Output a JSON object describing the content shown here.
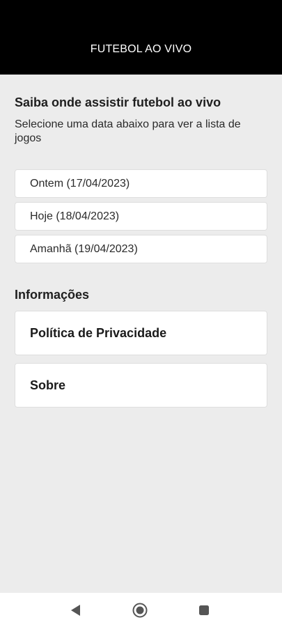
{
  "app_bar": {
    "title": "FUTEBOL AO VIVO"
  },
  "intro": {
    "heading": "Saiba onde assistir futebol ao vivo",
    "subheading": "Selecione uma data abaixo para ver a lista de jogos"
  },
  "dates": [
    {
      "label": "Ontem (17/04/2023)"
    },
    {
      "label": "Hoje (18/04/2023)"
    },
    {
      "label": "Amanhã (19/04/2023)"
    }
  ],
  "info": {
    "title": "Informações",
    "items": [
      {
        "label": "Política de Privacidade"
      },
      {
        "label": "Sobre"
      }
    ]
  },
  "nav": {
    "back_icon": "back-triangle-icon",
    "home_icon": "home-circle-icon",
    "recents_icon": "recents-square-icon",
    "icon_color": "#555555"
  },
  "colors": {
    "app_bar_bg": "#000000",
    "page_bg": "#ececec",
    "card_bg": "#ffffff"
  }
}
